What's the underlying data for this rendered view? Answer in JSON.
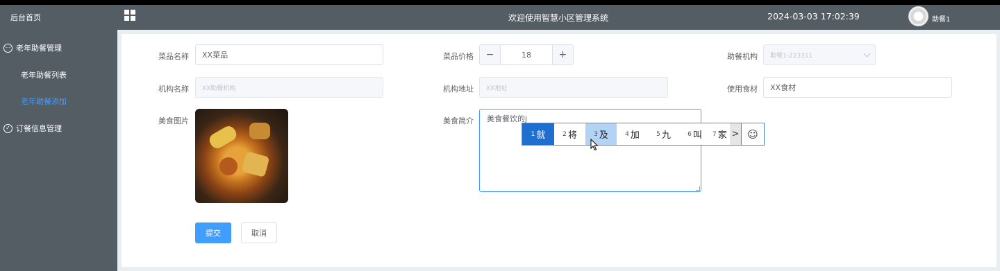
{
  "sidebar": {
    "home": "后台首页",
    "group1": {
      "label": "老年助餐管理",
      "icon": "chat-bubble-icon"
    },
    "items": [
      "老年助餐列表",
      "老年助餐添加"
    ],
    "group2": {
      "label": "订餐信息管理",
      "icon": "check-circle-icon"
    }
  },
  "header": {
    "title": "欢迎使用智慧小区管理系统",
    "datetime": "2024-03-03 17:02:39",
    "user": "助餐1"
  },
  "form": {
    "dish_name": {
      "label": "菜品名称",
      "value": "XX菜品"
    },
    "dish_price": {
      "label": "菜品价格",
      "value": "18",
      "minus": "−",
      "plus": "+"
    },
    "org": {
      "label": "助餐机构",
      "value": "助餐1-223311"
    },
    "org_name": {
      "label": "机构名称",
      "placeholder": "XX助餐机构"
    },
    "org_addr": {
      "label": "机构地址",
      "placeholder": "XX地址"
    },
    "ingredients": {
      "label": "使用食材",
      "value": "XX食材"
    },
    "image": {
      "label": "美食图片"
    },
    "intro": {
      "label": "美食简介",
      "value": "美食餐饮的j"
    },
    "submit": "提交",
    "cancel": "取消"
  },
  "ime": {
    "candidates": [
      {
        "num": "1",
        "text": "就"
      },
      {
        "num": "2",
        "text": "将"
      },
      {
        "num": "3",
        "text": "及"
      },
      {
        "num": "4",
        "text": "加"
      },
      {
        "num": "5",
        "text": "九"
      },
      {
        "num": "6",
        "text": "叫"
      },
      {
        "num": "7",
        "text": "家"
      }
    ],
    "next": ">",
    "emoji": "☺"
  }
}
